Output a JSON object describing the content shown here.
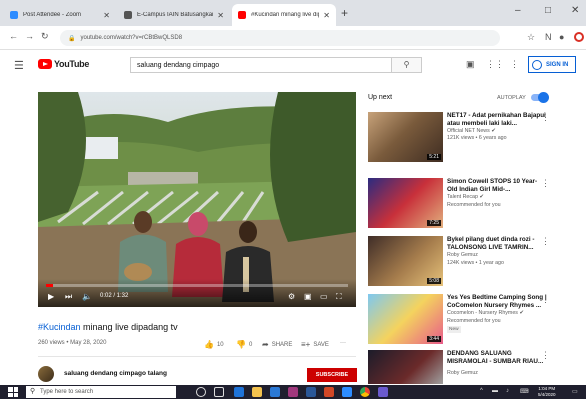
{
  "browser": {
    "tabs": [
      {
        "title": "Post Attendee - Zoom",
        "favicon_color": "#2d8cff"
      },
      {
        "title": "E-Campus IAIN Batusangkar",
        "favicon_color": "#555555"
      },
      {
        "title": "#Kucindan minang live dipa...",
        "favicon_color": "#ff0000"
      }
    ],
    "url": "youtube.com/watch?v=rCBtBwQLSD8",
    "new_tab": "+",
    "minimize": "–",
    "maximize": "□",
    "close": "✕"
  },
  "youtube": {
    "logo_text": "YouTube",
    "search_query": "saluang dendang cimpago",
    "sign_in": "SIGN IN"
  },
  "player": {
    "time": "0:02 / 1:32",
    "progress": 0.022
  },
  "video": {
    "hashtag": "#Kucindan",
    "title_rest": " minang live dipadang tv",
    "meta": "260 views • May 28, 2020",
    "likes": "10",
    "dislikes": "0",
    "share": "SHARE",
    "save": "SAVE",
    "more": "···"
  },
  "channel": {
    "name": "saluang dendang cimpago talang",
    "subscribe": "SUBSCRIBE"
  },
  "sidebar": {
    "up_next": "Up next",
    "autoplay": "AUTOPLAY",
    "videos": [
      {
        "title": "NET17 - Adat pernikahan Bajapui atau membeli laki laki...",
        "channel": "Official NET News ✔",
        "meta": "121K views • 6 years ago",
        "duration": "5:21",
        "badge": ""
      },
      {
        "title": "Simon Cowell STOPS 10 Year-Old Indian Girl Mid-...",
        "channel": "Talent Recap ✔",
        "meta": "Recommended for you",
        "duration": "7:25",
        "badge": ""
      },
      {
        "title": "Bykel pilang duet dinda rozi - TALONSONG LIVE TAMRIN...",
        "channel": "Roby Gemuz",
        "meta": "124K views • 1 year ago",
        "duration": "5:08",
        "badge": ""
      },
      {
        "title": "Yes Yes Bedtime Camping Song | CoComelon Nursery Rhymes ...",
        "channel": "Cocomelon - Nursery Rhymes ✔",
        "meta": "Recommended for you",
        "duration": "3:44",
        "badge": "New"
      },
      {
        "title": "DENDANG SALUANG MISRAMOLAI - SUMBAR RIAU...",
        "channel": "Roby Gemuz",
        "meta": "",
        "duration": "",
        "badge": ""
      }
    ]
  },
  "taskbar": {
    "search_placeholder": "Type here to search",
    "time": "1:04 PM",
    "date": "5/4/2020"
  }
}
